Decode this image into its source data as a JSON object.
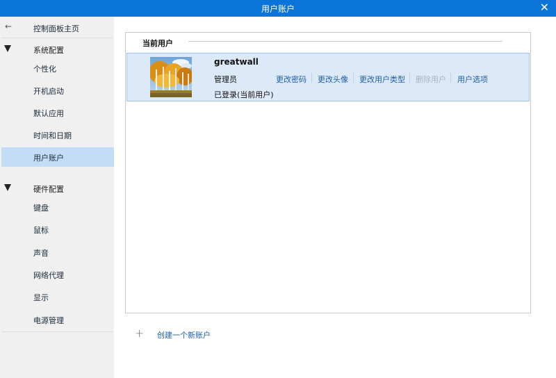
{
  "window": {
    "title": "用户账户",
    "close_glyph": "✕"
  },
  "sidebar": {
    "back_label": "控制面板主页",
    "groups": [
      {
        "label": "系统配置",
        "items": [
          "个性化",
          "开机启动",
          "默认应用",
          "时间和日期",
          "用户账户"
        ]
      },
      {
        "label": "硬件配置",
        "items": [
          "键盘",
          "鼠标",
          "声音",
          "网络代理",
          "显示",
          "电源管理"
        ]
      }
    ],
    "active_item": "用户账户"
  },
  "panel": {
    "heading": "当前用户",
    "user": {
      "name": "greatwall",
      "role": "管理员",
      "status": "已登录(当前用户)",
      "actions": [
        {
          "label": "更改密码",
          "enabled": true
        },
        {
          "label": "更改头像",
          "enabled": true
        },
        {
          "label": "更改用户类型",
          "enabled": true
        },
        {
          "label": "删除用户",
          "enabled": false
        },
        {
          "label": "用户选项",
          "enabled": true
        }
      ]
    }
  },
  "create_account": {
    "plus": "+",
    "label": "创建一个新账户"
  },
  "colors": {
    "accent": "#0a74d8",
    "link": "#1c5fa8",
    "selection": "#c3ddf6",
    "card": "#dce9f8"
  },
  "icons": {
    "back": "arrow-left-icon",
    "group": "triangle-down-icon",
    "add": "plus-icon"
  }
}
